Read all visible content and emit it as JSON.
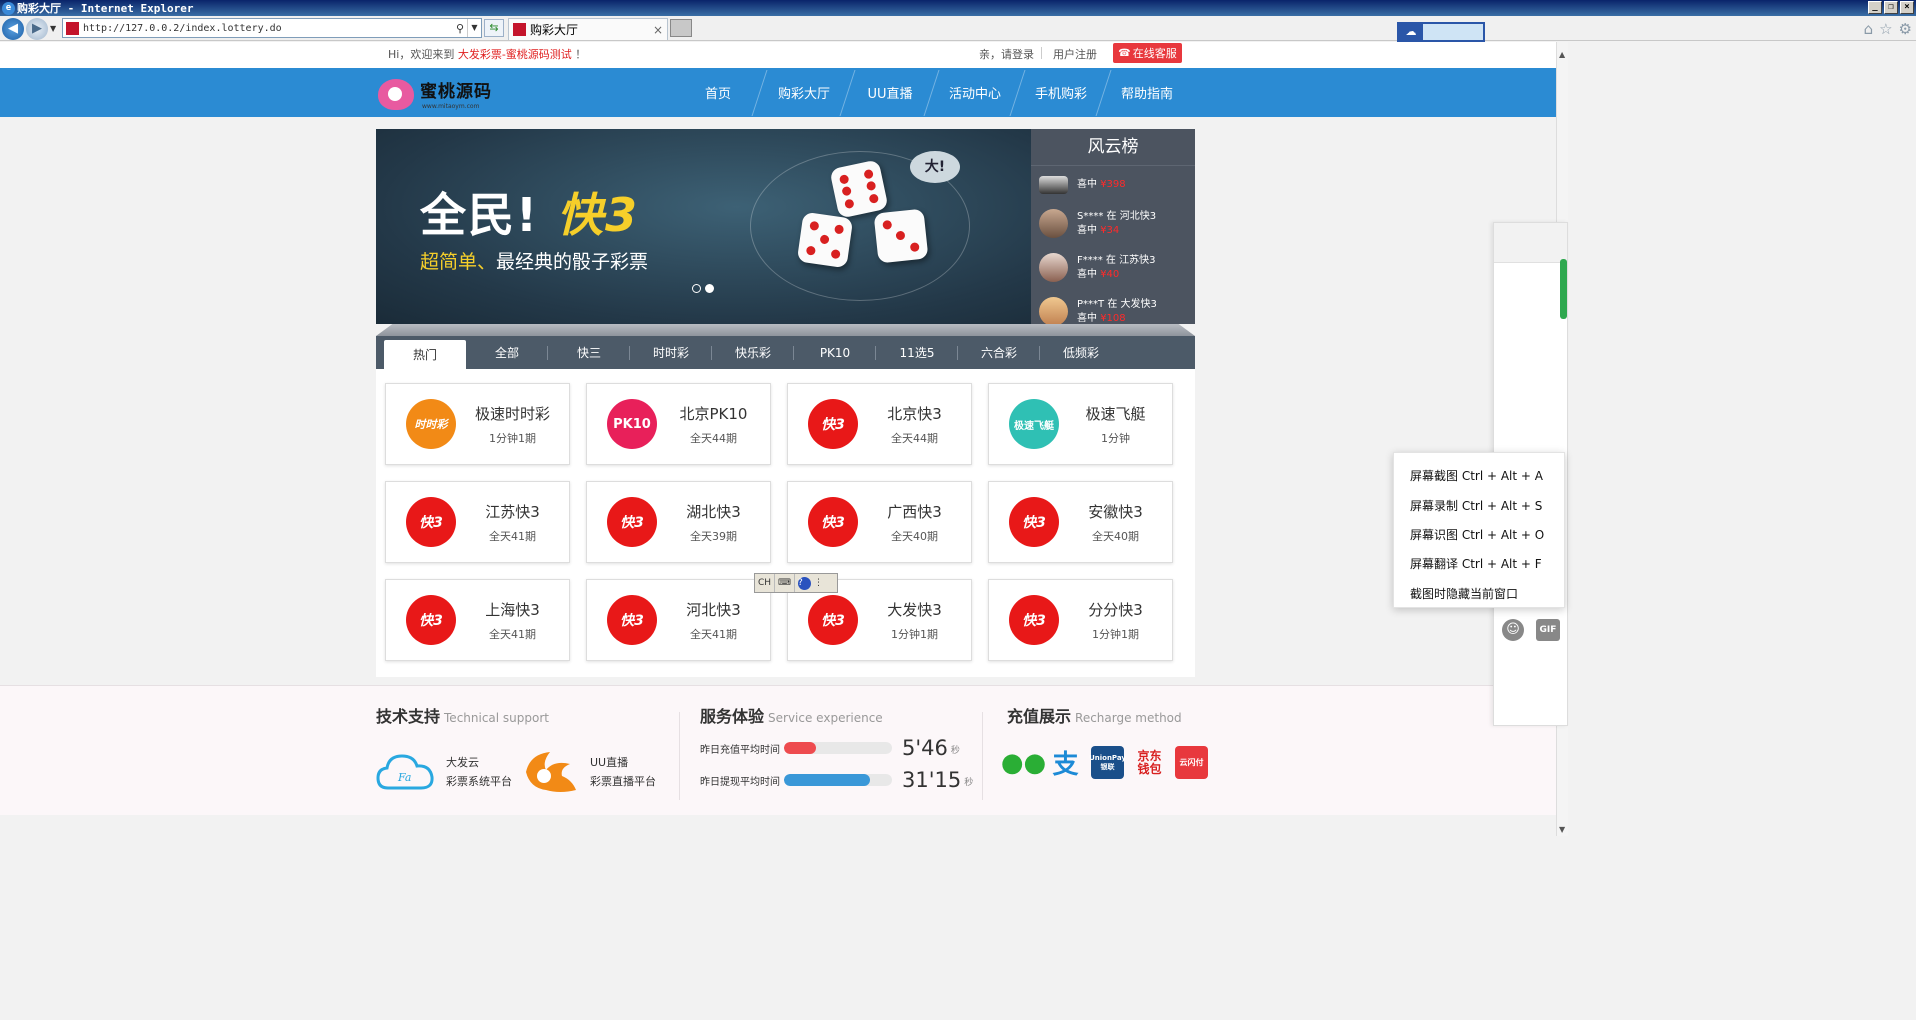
{
  "browser": {
    "window_title": "购彩大厅 - Internet Explorer",
    "address": "http://127.0.0.2/index.lottery.do",
    "tab_title": "购彩大厅",
    "tab_close": "×",
    "win_buttons": [
      "_",
      "❐",
      "×"
    ]
  },
  "topbar": {
    "welcome_prefix": "Hi，欢迎来到 ",
    "site_name": "大发彩票-蜜桃源码测试",
    "welcome_suffix": " ！",
    "login": "亲，请登录",
    "register": "用户注册",
    "service": "在线客服"
  },
  "header": {
    "logo_text": "蜜桃源码",
    "logo_sub": "www.mitaoym.com",
    "nav": [
      "首页",
      "购彩大厅",
      "UU直播",
      "活动中心",
      "手机购彩",
      "帮助指南"
    ]
  },
  "banner": {
    "title_main": "全民!",
    "title_accent": "快3",
    "slogan_accent": "超简单、",
    "slogan_rest": "最经典的骰子彩票",
    "bubble": "大!",
    "slides": 2,
    "active_slide": 2
  },
  "ranking": {
    "title": "风云榜",
    "items": [
      {
        "user": "",
        "line2": "喜中 ",
        "amount": "¥398"
      },
      {
        "user": "S**** 在 河北快3",
        "line2": "喜中 ",
        "amount": "¥34"
      },
      {
        "user": "F**** 在 江苏快3",
        "line2": "喜中 ",
        "amount": "¥40"
      },
      {
        "user": "P***T 在 大发快3",
        "line2": "喜中 ",
        "amount": "¥108"
      }
    ]
  },
  "tabs": [
    "热门",
    "全部",
    "快三",
    "时时彩",
    "快乐彩",
    "PK10",
    "11选5",
    "六合彩",
    "低频彩"
  ],
  "active_tab": "热门",
  "games": [
    {
      "name": "极速时时彩",
      "period": "1分钟1期",
      "icon": "ssc",
      "icon_text": "时时彩"
    },
    {
      "name": "北京PK10",
      "period": "全天44期",
      "icon": "pk10",
      "icon_text": "PK10"
    },
    {
      "name": "北京快3",
      "period": "全天44期",
      "icon": "k3",
      "icon_text": "快3"
    },
    {
      "name": "极速飞艇",
      "period": "1分钟",
      "icon": "boat",
      "icon_text": "极速飞艇"
    },
    {
      "name": "江苏快3",
      "period": "全天41期",
      "icon": "k3",
      "icon_text": "快3"
    },
    {
      "name": "湖北快3",
      "period": "全天39期",
      "icon": "k3",
      "icon_text": "快3"
    },
    {
      "name": "广西快3",
      "period": "全天40期",
      "icon": "k3",
      "icon_text": "快3"
    },
    {
      "name": "安徽快3",
      "period": "全天40期",
      "icon": "k3",
      "icon_text": "快3"
    },
    {
      "name": "上海快3",
      "period": "全天41期",
      "icon": "k3",
      "icon_text": "快3"
    },
    {
      "name": "河北快3",
      "period": "全天41期",
      "icon": "k3",
      "icon_text": "快3"
    },
    {
      "name": "大发快3",
      "period": "1分钟1期",
      "icon": "k3",
      "icon_text": "快3"
    },
    {
      "name": "分分快3",
      "period": "1分钟1期",
      "icon": "k3",
      "icon_text": "快3"
    }
  ],
  "footer": {
    "tech": {
      "title": "技术支持",
      "title_en": "Technical support",
      "partners": [
        {
          "name": "大发云",
          "desc": "彩票系统平台",
          "icon_text": "Fa"
        },
        {
          "name": "UU直播",
          "desc": "彩票直播平台",
          "icon_text": ""
        }
      ]
    },
    "service": {
      "title": "服务体验",
      "title_en": "Service experience",
      "stats": [
        {
          "label": "昨日充值平均时间",
          "value": "5'46",
          "unit": "秒",
          "fill": 0.3,
          "color": "#ee4b4f"
        },
        {
          "label": "昨日提现平均时间",
          "value": "31'15",
          "unit": "秒",
          "fill": 0.8,
          "color": "#3a98d8"
        }
      ]
    },
    "recharge": {
      "title": "充值展示",
      "title_en": "Recharge method",
      "methods": [
        {
          "name": "wechat-pay",
          "label": "",
          "color": "#2aae35"
        },
        {
          "name": "alipay",
          "label": "支",
          "color": "#1c8ad6"
        },
        {
          "name": "unionpay",
          "label": "UnionPay 银联",
          "color": "#1a4f8a"
        },
        {
          "name": "jd-wallet",
          "label": "京东 钱包",
          "color": "#d82020"
        },
        {
          "name": "cloud-flash-pay",
          "label": "云闪付",
          "color": "#e8383d"
        }
      ]
    }
  },
  "ime": {
    "mode": "CH",
    "keyboard": "⌨",
    "help": "?",
    "menu": "⋮"
  },
  "context_menu": [
    "屏幕截图 Ctrl + Alt + A",
    "屏幕录制 Ctrl + Alt + S",
    "屏幕识图 Ctrl + Alt + O",
    "屏幕翻译 Ctrl + Alt + F",
    "截图时隐藏当前窗口"
  ],
  "side_panel": {
    "gif_label": "GIF",
    "emoji_glyph": "☺"
  },
  "colors": {
    "header_blue": "#2b8bd3",
    "accent_red": "#e8383d",
    "k3_red": "#e81818",
    "rank_bg": "#4c5460",
    "tab_bg": "#4c5a68"
  }
}
